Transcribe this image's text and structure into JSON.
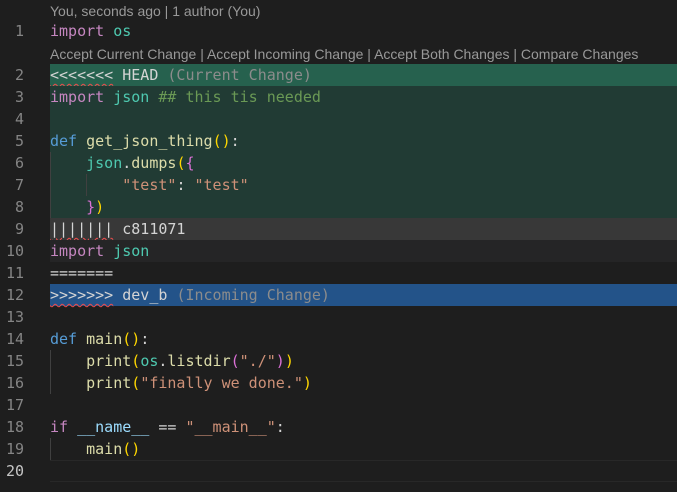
{
  "blame": "You, seconds ago | 1 author (You)",
  "codelens": {
    "accept_current": "Accept Current Change",
    "accept_incoming": "Accept Incoming Change",
    "accept_both": "Accept Both Changes",
    "compare": "Compare Changes",
    "separator": "|"
  },
  "line_numbers": [
    "1",
    "2",
    "3",
    "4",
    "5",
    "6",
    "7",
    "8",
    "9",
    "10",
    "11",
    "12",
    "13",
    "14",
    "15",
    "16",
    "17",
    "18",
    "19",
    "20"
  ],
  "code": {
    "l1": {
      "kw": "import",
      "mod": "os"
    },
    "l2": {
      "marker": "<<<<<<<",
      "label": "HEAD",
      "hint": "(Current Change)"
    },
    "l3": {
      "kw": "import",
      "mod": "json",
      "comment": "## this tis needed"
    },
    "l5": {
      "kw": "def",
      "fn": "get_json_thing",
      "p1": "(",
      "p2": ")",
      "colon": ":"
    },
    "l6": {
      "obj": "json",
      "dot": ".",
      "fn": "dumps",
      "p1": "(",
      "b": "{"
    },
    "l7": {
      "key": "\"test\"",
      "colon": ": ",
      "val": "\"test\""
    },
    "l8": {
      "b": "}",
      "p": ")"
    },
    "l9": {
      "marker": "|||||||",
      "label": "c811071"
    },
    "l10": {
      "kw": "import",
      "mod": "json"
    },
    "l11": {
      "marker": "======="
    },
    "l12": {
      "marker": ">>>>>>>",
      "label": "dev_b",
      "hint": "(Incoming Change)"
    },
    "l14": {
      "kw": "def",
      "fn": "main",
      "p1": "(",
      "p2": ")",
      "colon": ":"
    },
    "l15": {
      "fn": "print",
      "p1": "(",
      "obj": "os",
      "dot": ".",
      "fn2": "listdir",
      "p2": "(",
      "str": "\"./\"",
      "p3": ")",
      "p4": ")"
    },
    "l16": {
      "fn": "print",
      "p1": "(",
      "str": "\"finally we done.\"",
      "p2": ")"
    },
    "l18": {
      "kw": "if",
      "name": "__name__",
      "op": " == ",
      "str": "\"__main__\"",
      "colon": ":"
    },
    "l19": {
      "fn": "main",
      "p1": "(",
      "p2": ")"
    }
  }
}
